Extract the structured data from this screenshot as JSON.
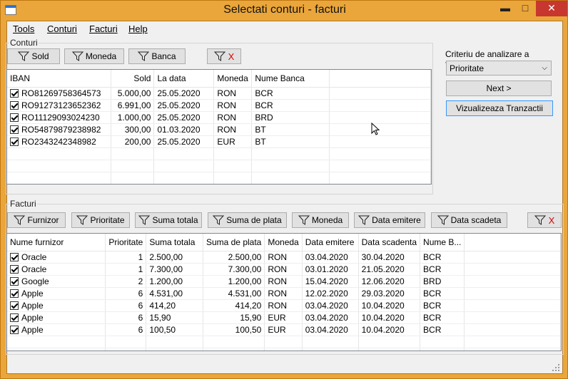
{
  "window": {
    "title": "Selectati conturi - facturi",
    "minimize_glyph": "▬",
    "maximize_glyph": "□",
    "close_glyph": "✕"
  },
  "menu": {
    "items": [
      "Tools",
      "Conturi",
      "Facturi",
      "Help"
    ]
  },
  "conturi": {
    "group_label": "Conturi",
    "filter_buttons": [
      {
        "label": "Sold",
        "icon": "filter-icon"
      },
      {
        "label": "Moneda",
        "icon": "filter-icon"
      },
      {
        "label": "Banca",
        "icon": "filter-icon"
      }
    ],
    "clear_filter_label": "X",
    "columns": [
      "IBAN",
      "Sold",
      "La data",
      "Moneda",
      "Nume Banca"
    ],
    "rows": [
      {
        "checked": true,
        "iban": "RO81269758364573",
        "sold": "5.000,00",
        "la_data": "25.05.2020",
        "moneda": "RON",
        "banca": "BCR"
      },
      {
        "checked": true,
        "iban": "RO91273123652362",
        "sold": "6.991,00",
        "la_data": "25.05.2020",
        "moneda": "RON",
        "banca": "BCR"
      },
      {
        "checked": true,
        "iban": "RO11129093024230",
        "sold": "1.000,00",
        "la_data": "25.05.2020",
        "moneda": "RON",
        "banca": "BRD"
      },
      {
        "checked": true,
        "iban": "RO54879879238982",
        "sold": "300,00",
        "la_data": "01.03.2020",
        "moneda": "RON",
        "banca": "BT"
      },
      {
        "checked": true,
        "iban": "RO2343242348982",
        "sold": "200,00",
        "la_data": "25.05.2020",
        "moneda": "EUR",
        "banca": "BT"
      }
    ]
  },
  "side_panel": {
    "criteriu_label": "Criteriu de analizare a facturilor",
    "criteriu_value": "Prioritate",
    "next_label": "Next >",
    "vizualizeaza_label": "Vizualizeaza Tranzactii"
  },
  "facturi": {
    "group_label": "Facturi",
    "filter_buttons": [
      {
        "label": "Furnizor",
        "icon": "filter-icon"
      },
      {
        "label": "Prioritate",
        "icon": "filter-icon"
      },
      {
        "label": "Suma totala",
        "icon": "filter-icon"
      },
      {
        "label": "Suma de plata",
        "icon": "filter-icon"
      },
      {
        "label": "Moneda",
        "icon": "filter-icon"
      },
      {
        "label": "Data emitere",
        "icon": "filter-icon"
      },
      {
        "label": "Data scadeta",
        "icon": "filter-icon"
      }
    ],
    "clear_filter_label": "X",
    "columns": [
      "Nume furnizor",
      "Prioritate",
      "Suma totala",
      "Suma de plata",
      "Moneda",
      "Data emitere",
      "Data scadenta",
      "Nume B..."
    ],
    "rows": [
      {
        "checked": true,
        "furnizor": "Oracle",
        "prioritate": "1",
        "suma_totala": "2.500,00",
        "suma_plata": "2.500,00",
        "moneda": "RON",
        "emitere": "03.04.2020",
        "scadenta": "30.04.2020",
        "banca": "BCR"
      },
      {
        "checked": true,
        "furnizor": "Oracle",
        "prioritate": "1",
        "suma_totala": "7.300,00",
        "suma_plata": "7.300,00",
        "moneda": "RON",
        "emitere": "03.01.2020",
        "scadenta": "21.05.2020",
        "banca": "BCR"
      },
      {
        "checked": true,
        "furnizor": "Google",
        "prioritate": "2",
        "suma_totala": "1.200,00",
        "suma_plata": "1.200,00",
        "moneda": "RON",
        "emitere": "15.04.2020",
        "scadenta": "12.06.2020",
        "banca": "BRD"
      },
      {
        "checked": true,
        "furnizor": "Apple",
        "prioritate": "6",
        "suma_totala": "4.531,00",
        "suma_plata": "4.531,00",
        "moneda": "RON",
        "emitere": "12.02.2020",
        "scadenta": "29.03.2020",
        "banca": "BCR"
      },
      {
        "checked": true,
        "furnizor": "Apple",
        "prioritate": "6",
        "suma_totala": "414,20",
        "suma_plata": "414,20",
        "moneda": "RON",
        "emitere": "03.04.2020",
        "scadenta": "10.04.2020",
        "banca": "BCR"
      },
      {
        "checked": true,
        "furnizor": "Apple",
        "prioritate": "6",
        "suma_totala": "15,90",
        "suma_plata": "15,90",
        "moneda": "EUR",
        "emitere": "03.04.2020",
        "scadenta": "10.04.2020",
        "banca": "BCR"
      },
      {
        "checked": true,
        "furnizor": "Apple",
        "prioritate": "6",
        "suma_totala": "100,50",
        "suma_plata": "100,50",
        "moneda": "EUR",
        "emitere": "03.04.2020",
        "scadenta": "10.04.2020",
        "banca": "BCR"
      }
    ]
  }
}
